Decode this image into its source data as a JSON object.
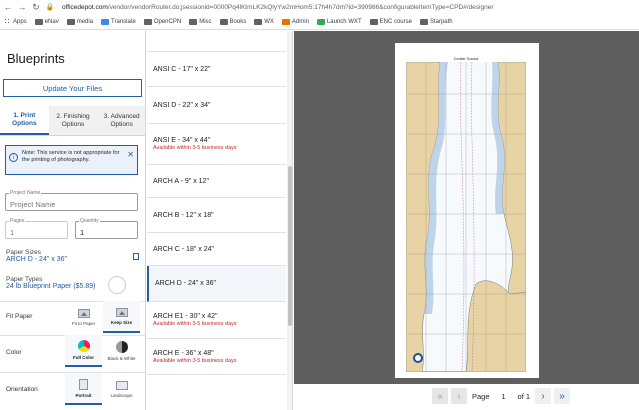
{
  "browser": {
    "url_host": "officedepot.com",
    "url_path": "/vendor/vendorRouter.do;jsessionid=0000Pq4lKtmLK2kQlyYw2mHom5:17h4h7dm?id=390986&configurableItemType=CPD#/designer",
    "bookmarks": [
      "Apps",
      "eNav",
      "media",
      "Translate",
      "OpenCPN",
      "Misc",
      "Books",
      "WX",
      "Admin",
      "Launch WXT",
      "ENC course",
      "Starpath"
    ]
  },
  "left": {
    "title": "Blueprints",
    "update_button": "Update Your Files",
    "tabs": [
      "1. Print Options",
      "2. Finishing Options",
      "3. Advanced Options"
    ],
    "note": "Note: This service is not appropriate for the printing of photography.",
    "project_name_label": "Project Name",
    "project_name_placeholder": "Project Name",
    "pages_label": "Pages",
    "pages_value": "1",
    "quantity_label": "Quantity",
    "quantity_value": "1",
    "paper_sizes_label": "Paper Sizes",
    "paper_sizes_value": "ARCH D - 24\" x 36\"",
    "paper_types_label": "Paper Types",
    "paper_types_value": "24 lb Blueprint Paper ($5.89)",
    "fit_paper_label": "Fit Paper",
    "fit_options": [
      "Fit to Paper",
      "Keep Size"
    ],
    "color_label": "Color",
    "color_options": [
      "Full Color",
      "Black & White"
    ],
    "orientation_label": "Orientation",
    "orientation_options": [
      "Portrait",
      "Landscape"
    ]
  },
  "sizes": [
    {
      "name": "ANSI C - 17\" x 22\"",
      "note": ""
    },
    {
      "name": "ANSI D - 22\" x 34\"",
      "note": ""
    },
    {
      "name": "ANSI E - 34\" x 44\"",
      "note": "Available within 3-5 business days"
    },
    {
      "name": "ARCH A - 9\" x 12\"",
      "note": ""
    },
    {
      "name": "ARCH B - 12\" x 18\"",
      "note": ""
    },
    {
      "name": "ARCH C - 18\" x 24\"",
      "note": ""
    },
    {
      "name": "ARCH D - 24\" x 36\"",
      "note": ""
    },
    {
      "name": "ARCH E1 - 30\" x 42\"",
      "note": "Available within 3-5 business days"
    },
    {
      "name": "ARCH E - 36\" x 48\"",
      "note": "Available within 3-5 business days"
    }
  ],
  "preview": {
    "map_title": "Center Sound",
    "page_label": "Page",
    "page_value": "1",
    "of_label": "of 1"
  },
  "colors": {
    "accent": "#1f5fa8",
    "alert": "#c62828",
    "land": "#e8d3a5",
    "water": "#ffffff",
    "shallow": "#b8cfe6"
  }
}
